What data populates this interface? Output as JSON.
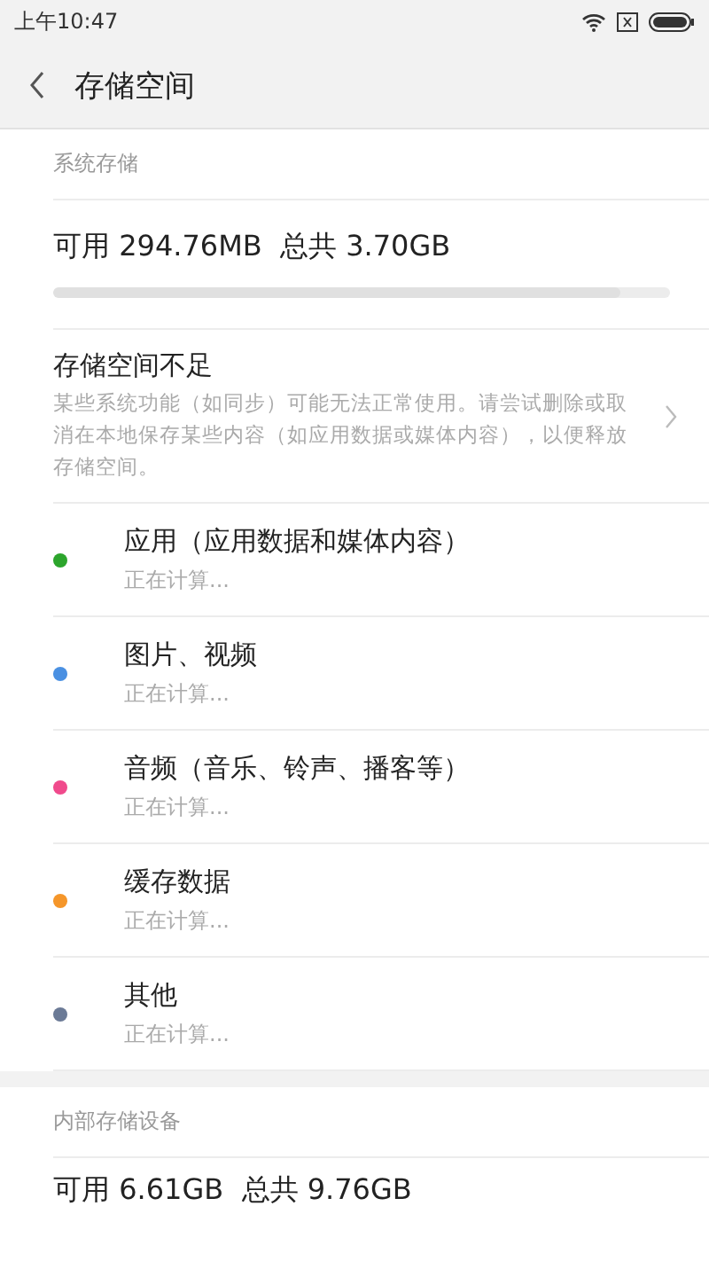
{
  "status_bar": {
    "time": "上午10:47"
  },
  "header": {
    "title": "存储空间"
  },
  "system_storage": {
    "heading": "系统存储",
    "summary": "可用 294.76MB  总共 3.70GB",
    "level": 0.92,
    "warning": {
      "title": "存储空间不足",
      "text": "某些系统功能（如同步）可能无法正常使用。请尝试删除或取消在本地保存某些内容（如应用数据或媒体内容），以便释放存储空间。"
    },
    "categories": [
      {
        "name": "应用（应用数据和媒体内容）",
        "status": "正在计算...",
        "color": "#2ca52c"
      },
      {
        "name": "图片、视频",
        "status": "正在计算...",
        "color": "#4a90e2"
      },
      {
        "name": "音频（音乐、铃声、播客等）",
        "status": "正在计算...",
        "color": "#f04a8c"
      },
      {
        "name": "缓存数据",
        "status": "正在计算...",
        "color": "#f5962a"
      },
      {
        "name": "其他",
        "status": "正在计算...",
        "color": "#6b7a96"
      }
    ]
  },
  "internal_storage": {
    "heading": "内部存储设备",
    "summary": "可用 6.61GB  总共 9.76GB"
  }
}
